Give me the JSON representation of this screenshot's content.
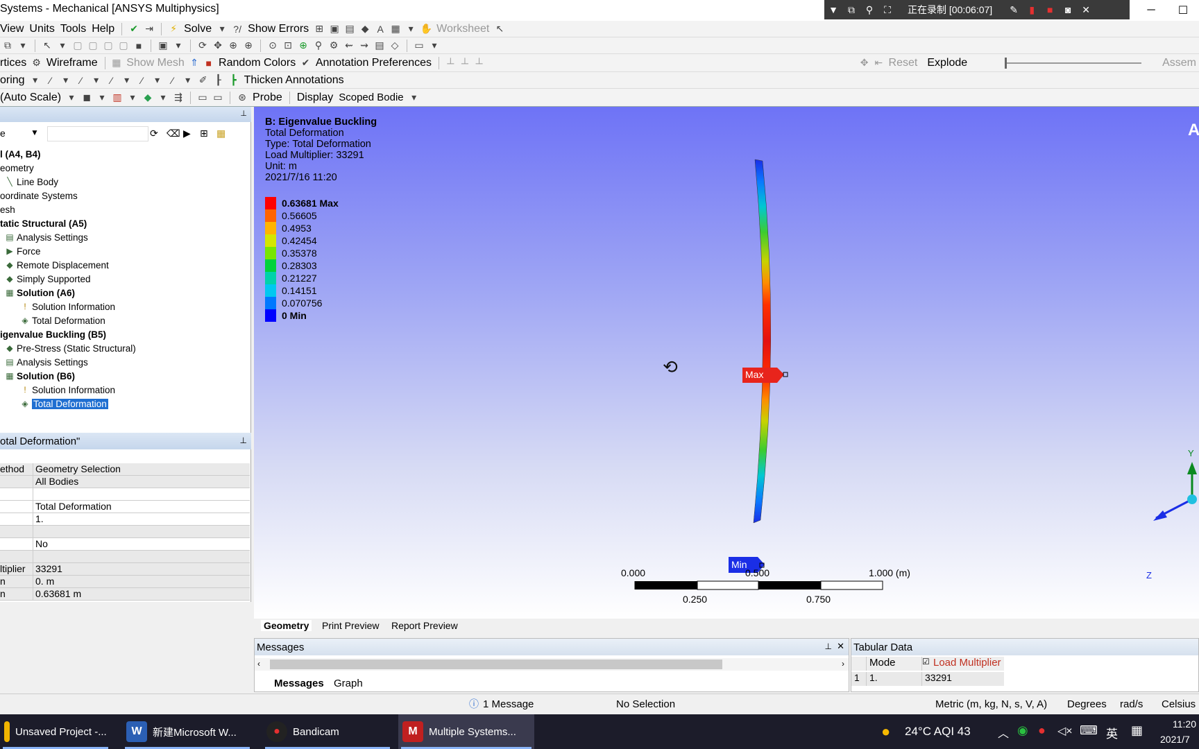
{
  "window": {
    "title": "Systems - Mechanical [ANSYS Multiphysics]",
    "controls": [
      "─",
      "☐"
    ]
  },
  "recorder": {
    "status": "正在录制 [00:06:07]"
  },
  "menu": {
    "items": [
      "View",
      "Units",
      "Tools",
      "Help"
    ],
    "solve": "Solve",
    "show_errors": "Show Errors",
    "worksheet": "Worksheet"
  },
  "toolbar2": {},
  "toolbar3": {
    "vertices": "rtices",
    "wireframe": "Wireframe",
    "show_mesh": "Show Mesh",
    "random_colors": "Random Colors",
    "annotation_prefs": "Annotation Preferences",
    "reset": "Reset",
    "explode": "Explode",
    "assembly": "Assem"
  },
  "toolbar4": {
    "coloring": "oring",
    "thicken": "Thicken Annotations"
  },
  "toolbar5": {
    "scale": "(Auto Scale)",
    "probe": "Probe",
    "display": "Display",
    "scoped": "Scoped Bodie"
  },
  "outline": {
    "filter": "e",
    "items": [
      {
        "label": "l (A4, B4)",
        "bold": true,
        "icon": ""
      },
      {
        "label": "eometry",
        "bold": false,
        "icon": ""
      },
      {
        "label": "Line Body",
        "bold": false,
        "icon": "╲"
      },
      {
        "label": "oordinate Systems",
        "bold": false,
        "icon": ""
      },
      {
        "label": "esh",
        "bold": false,
        "icon": ""
      },
      {
        "label": "tatic Structural (A5)",
        "bold": true,
        "icon": ""
      },
      {
        "label": "Analysis Settings",
        "bold": false,
        "icon": "▤"
      },
      {
        "label": "Force",
        "bold": false,
        "icon": "▶"
      },
      {
        "label": "Remote Displacement",
        "bold": false,
        "icon": "◆"
      },
      {
        "label": "Simply Supported",
        "bold": false,
        "icon": "◆"
      },
      {
        "label": "Solution (A6)",
        "bold": true,
        "icon": "▦"
      },
      {
        "label": "Solution Information",
        "bold": false,
        "icon": "!"
      },
      {
        "label": "Total Deformation",
        "bold": false,
        "icon": "◈"
      },
      {
        "label": "igenvalue Buckling (B5)",
        "bold": true,
        "icon": ""
      },
      {
        "label": "Pre-Stress (Static Structural)",
        "bold": false,
        "icon": "◆"
      },
      {
        "label": "Analysis Settings",
        "bold": false,
        "icon": "▤"
      },
      {
        "label": "Solution (B6)",
        "bold": true,
        "icon": "▦"
      },
      {
        "label": "Solution Information",
        "bold": false,
        "icon": "!"
      },
      {
        "label": "Total Deformation",
        "bold": false,
        "icon": "◈",
        "selected": true
      }
    ]
  },
  "details": {
    "title": "otal Deformation\"",
    "rows": [
      {
        "k": "ethod",
        "v": "Geometry Selection",
        "shade": true
      },
      {
        "k": "",
        "v": "All Bodies",
        "shade": true
      },
      {
        "k": "",
        "v": "",
        "shade": false
      },
      {
        "k": "",
        "v": "Total Deformation",
        "shade": false
      },
      {
        "k": "",
        "v": "1.",
        "shade": false
      },
      {
        "k": "",
        "v": "",
        "shade": true
      },
      {
        "k": "",
        "v": "No",
        "shade": false
      },
      {
        "k": "",
        "v": "",
        "shade": true
      },
      {
        "k": "ltiplier",
        "v": "33291",
        "shade": true
      },
      {
        "k": "n",
        "v": "0. m",
        "shade": true
      },
      {
        "k": "n",
        "v": "0.63681 m",
        "shade": true
      }
    ]
  },
  "viewport": {
    "info": {
      "title": "B: Eigenvalue Buckling",
      "lines": [
        "Total Deformation",
        "Type: Total Deformation",
        "Load Multiplier: 33291",
        "Unit: m",
        "2021/7/16 11:20"
      ]
    },
    "legend": [
      {
        "label": "0.63681 Max",
        "color": "#ff0000",
        "bold": true
      },
      {
        "label": "0.56605",
        "color": "#ff6400",
        "bold": false
      },
      {
        "label": "0.4953",
        "color": "#ffb400",
        "bold": false
      },
      {
        "label": "0.42454",
        "color": "#d4e600",
        "bold": false
      },
      {
        "label": "0.35378",
        "color": "#78e600",
        "bold": false
      },
      {
        "label": "0.28303",
        "color": "#00d23c",
        "bold": false
      },
      {
        "label": "0.21227",
        "color": "#00d2aa",
        "bold": false
      },
      {
        "label": "0.14151",
        "color": "#00c8f0",
        "bold": false
      },
      {
        "label": "0.070756",
        "color": "#0078ff",
        "bold": false
      },
      {
        "label": "0 Min",
        "color": "#0000ff",
        "bold": true
      }
    ],
    "max_label": "Max",
    "min_label": "Min",
    "scale": {
      "top": [
        "0.000",
        "0.500",
        "1.000 (m)"
      ],
      "bottom": [
        "0.250",
        "0.750"
      ]
    },
    "triad": {
      "y": "Y",
      "z": "Z"
    },
    "corner": "A"
  },
  "view_tabs": [
    "Geometry",
    "Print Preview",
    "Report Preview"
  ],
  "messages": {
    "title": "Messages",
    "tabs": [
      "Messages",
      "Graph"
    ]
  },
  "tabular": {
    "title": "Tabular Data",
    "headers": [
      "Mode",
      "Load Multiplier"
    ],
    "rows": [
      [
        "1",
        "1.",
        "33291"
      ]
    ]
  },
  "status": {
    "message": "1 Message",
    "selection": "No Selection",
    "units": "Metric (m, kg, N, s, V, A)",
    "degrees": "Degrees",
    "rads": "rad/s",
    "temp": "Celsius"
  },
  "taskbar": {
    "tasks": [
      "Unsaved Project -...",
      "新建Microsoft W...",
      "Bandicam",
      "Multiple Systems..."
    ],
    "weather": "24°C AQI 43",
    "ime": "英",
    "time": "11:20",
    "date": "2021/7"
  },
  "colors": {
    "accent": "#1f6fd1",
    "max_tag": "#e8241c",
    "min_tag": "#1a2ee6"
  }
}
